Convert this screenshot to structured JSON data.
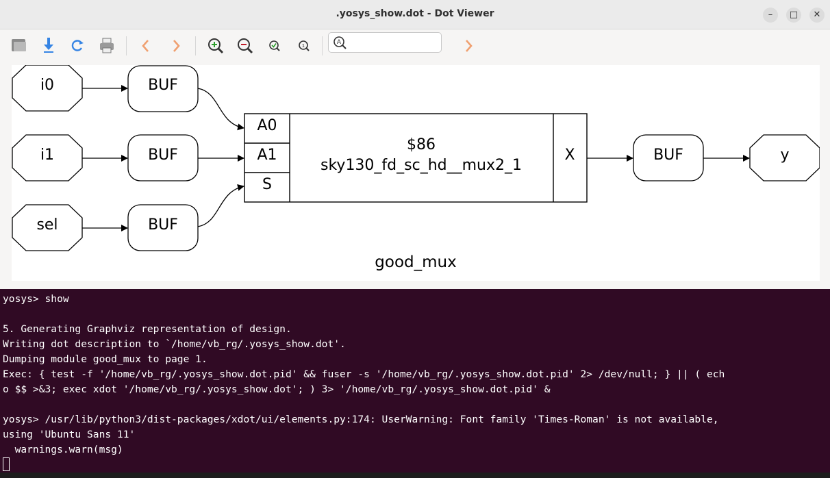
{
  "window": {
    "title": ".yosys_show.dot - Dot Viewer"
  },
  "window_buttons": {
    "minimize": "–",
    "maximize": "□",
    "close": "✕"
  },
  "toolbar": {
    "search": {
      "value": "",
      "placeholder": ""
    },
    "icons": [
      "open-icon",
      "save-icon",
      "reload-icon",
      "print-icon",
      "back-icon",
      "forward-icon",
      "zoom-in-icon",
      "zoom-out-icon",
      "zoom-fit-icon",
      "zoom-100-icon",
      "find-next-icon"
    ]
  },
  "graph": {
    "inputs": [
      "i0",
      "i1",
      "sel"
    ],
    "buf_label": "BUF",
    "cell": {
      "id": "$86",
      "type": "sky130_fd_sc_hd__mux2_1",
      "ports_in": [
        "A0",
        "A1",
        "S"
      ],
      "port_out": "X"
    },
    "output": "y",
    "module_name": "good_mux"
  },
  "terminal": {
    "lines": [
      "yosys> show",
      "",
      "5. Generating Graphviz representation of design.",
      "Writing dot description to `/home/vb_rg/.yosys_show.dot'.",
      "Dumping module good_mux to page 1.",
      "Exec: { test -f '/home/vb_rg/.yosys_show.dot.pid' && fuser -s '/home/vb_rg/.yosys_show.dot.pid' 2> /dev/null; } || ( ech",
      "o $$ >&3; exec xdot '/home/vb_rg/.yosys_show.dot'; ) 3> '/home/vb_rg/.yosys_show.dot.pid' &",
      "",
      "yosys> /usr/lib/python3/dist-packages/xdot/ui/elements.py:174: UserWarning: Font family 'Times-Roman' is not available,",
      "using 'Ubuntu Sans 11'",
      "  warnings.warn(msg)"
    ]
  },
  "colors": {
    "terminal_bg": "#300a24",
    "window_bg": "#f6f5f4",
    "accent_blue": "#3584e4",
    "nav_orange": "#e66100"
  }
}
